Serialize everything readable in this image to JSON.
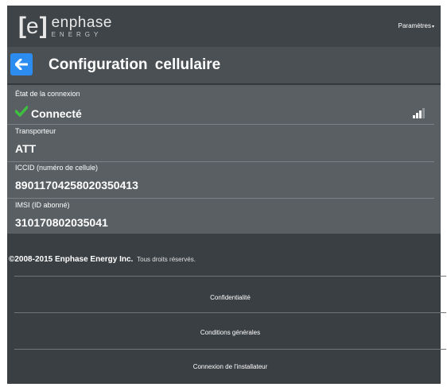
{
  "header": {
    "logo_text": "enphase",
    "logo_sub": "ENERGY",
    "settings_label": "Paramètres"
  },
  "page": {
    "title": "Configuration  cellulaire"
  },
  "fields": [
    {
      "label": "État de la connexion",
      "value": "Connecté"
    },
    {
      "label": "Transporteur",
      "value": "ATT"
    },
    {
      "label": "ICCID (numéro de cellule)",
      "value": "89011704258020350413"
    },
    {
      "label": "IMSI (ID abonné)",
      "value": "310170802035041"
    }
  ],
  "signal": {
    "bars_total": 4,
    "bars_active": 3
  },
  "footer": {
    "copyright_bold": "©2008-2015 Enphase Energy Inc.",
    "copyright_small": "Tous droits réservés.",
    "links": [
      "Confidentialité",
      "Conditions générales",
      "Connexion de l'installateur"
    ]
  },
  "colors": {
    "accent": "#2d8cf0",
    "check": "#3fbf3f",
    "background": "#3a3f43",
    "panel": "#595f63"
  }
}
